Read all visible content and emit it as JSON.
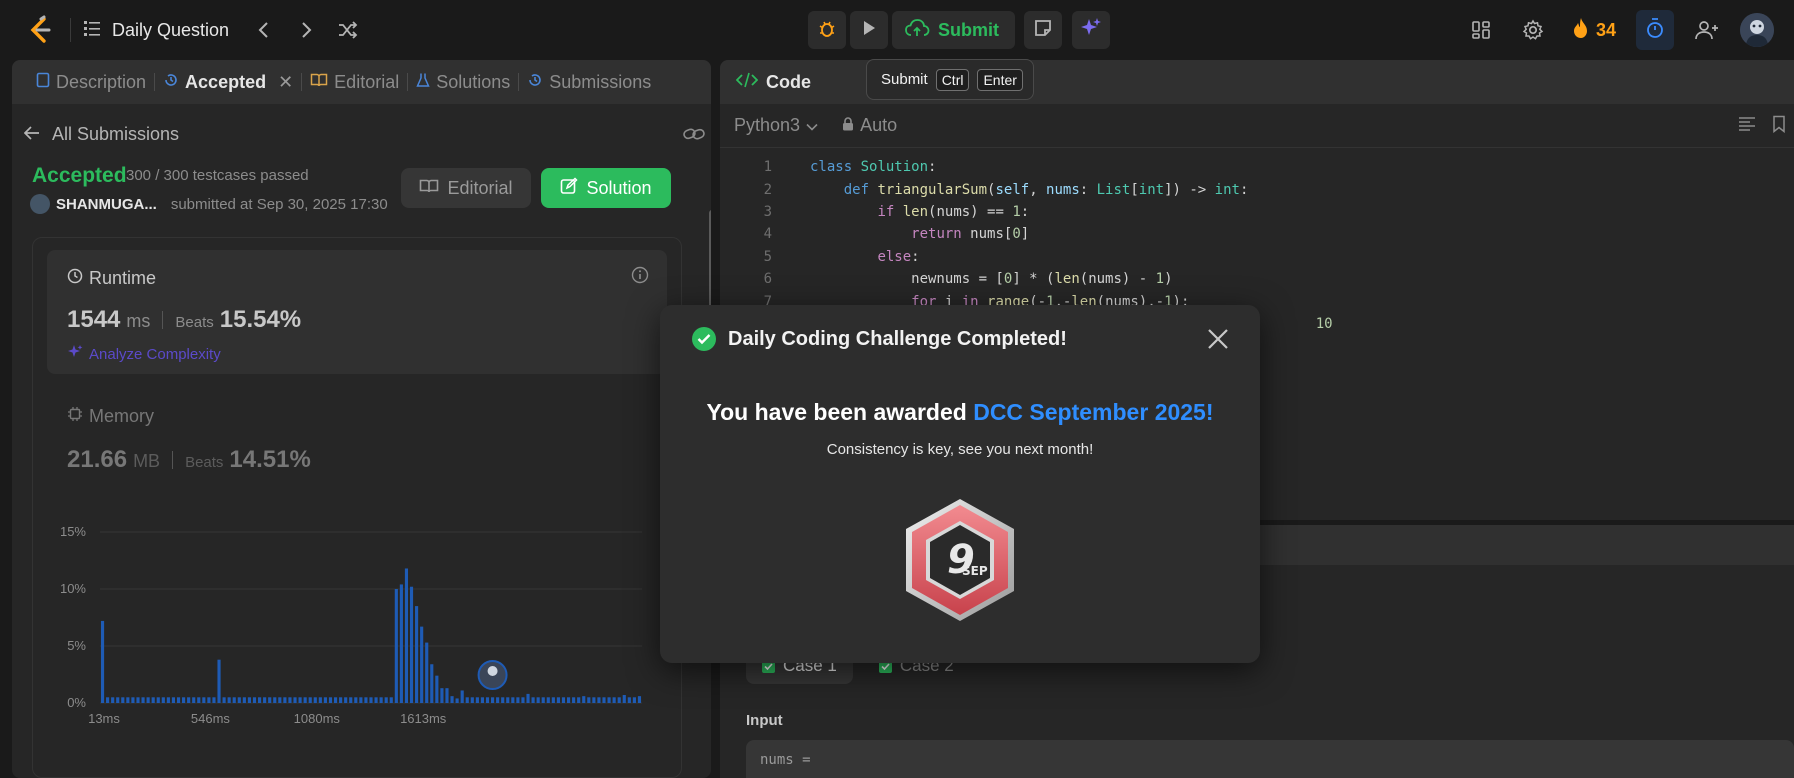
{
  "navbar": {
    "daily_question": "Daily Question",
    "submit_label": "Submit",
    "streak_count": "34"
  },
  "tooltip": {
    "label": "Submit",
    "key1": "Ctrl",
    "key2": "Enter"
  },
  "left_tabs": [
    {
      "label": "Description"
    },
    {
      "label": "Accepted"
    },
    {
      "label": "Editorial"
    },
    {
      "label": "Solutions"
    },
    {
      "label": "Submissions"
    }
  ],
  "submission": {
    "back_label": "All Submissions",
    "status": "Accepted",
    "testcases": "300 / 300 testcases passed",
    "username": "SHANMUGA...",
    "submitted_at": "submitted at Sep 30, 2025 17:30",
    "editorial_btn": "Editorial",
    "solution_btn": "Solution"
  },
  "runtime": {
    "title": "Runtime",
    "value": "1544",
    "unit": "ms",
    "beats_label": "Beats",
    "beats_value": "15.54%",
    "analyze": "Analyze Complexity"
  },
  "memory": {
    "title": "Memory",
    "value": "21.66",
    "unit": "MB",
    "beats_label": "Beats",
    "beats_value": "14.51%"
  },
  "chart_data": {
    "type": "bar",
    "title": "",
    "xlabel": "",
    "ylabel": "",
    "ylim": [
      0,
      15
    ],
    "y_ticks": [
      "15%",
      "10%",
      "5%",
      "0%"
    ],
    "x_ticks": [
      "13ms",
      "546ms",
      "1080ms",
      "1613ms"
    ],
    "series": [
      {
        "values": [
          7.2,
          0.5,
          0.5,
          0.5,
          0.5,
          0.5,
          0.5,
          0.5,
          0.5,
          0.5,
          0.5,
          0.5,
          0.5,
          0.5,
          0.5,
          0.5,
          0.5,
          0.5,
          0.5,
          0.5,
          0.5,
          0.5,
          0.5,
          3.8,
          0.5,
          0.5,
          0.5,
          0.5,
          0.5,
          0.5,
          0.5,
          0.5,
          0.5,
          0.5,
          0.5,
          0.5,
          0.5,
          0.5,
          0.5,
          0.5,
          0.5,
          0.5,
          0.5,
          0.5,
          0.5,
          0.5,
          0.5,
          0.5,
          0.5,
          0.5,
          0.5,
          0.5,
          0.5,
          0.5,
          0.5,
          0.5,
          0.5,
          0.5,
          10.0,
          10.4,
          11.8,
          10.2,
          8.5,
          6.7,
          5.3,
          3.4,
          2.4,
          1.3,
          1.3,
          0.6,
          0.4,
          1.1,
          0.5,
          0.5,
          0.5,
          0.5,
          0.5,
          0.5,
          0.5,
          0.5,
          0.5,
          0.5,
          0.5,
          0.5,
          0.8,
          0.5,
          0.5,
          0.5,
          0.5,
          0.5,
          0.5,
          0.5,
          0.5,
          0.5,
          0.5,
          0.6,
          0.5,
          0.5,
          0.5,
          0.5,
          0.5,
          0.5,
          0.5,
          0.7,
          0.5,
          0.5,
          0.6
        ]
      }
    ],
    "user_marker_index": 77,
    "bar_color": "#1e5bb5"
  },
  "code_panel": {
    "title": "Code",
    "language": "Python3",
    "auto": "Auto"
  },
  "code_lines": [
    {
      "n": "1"
    },
    {
      "n": "2"
    },
    {
      "n": "3"
    },
    {
      "n": "4"
    },
    {
      "n": "5"
    },
    {
      "n": "6"
    },
    {
      "n": "7"
    }
  ],
  "testcases": {
    "case1": "Case 1",
    "case2": "Case 2",
    "input_label": "Input",
    "input_value": "nums ="
  },
  "modal": {
    "title": "Daily Coding Challenge Completed!",
    "award_prefix": "You have been awarded ",
    "award_name": "DCC September 2025!",
    "subtitle": "Consistency is key, see you next month!",
    "badge_number": "9",
    "badge_month": "SEP"
  },
  "colors": {
    "accent_green": "#2cbb5d",
    "accent_orange": "#ffa116",
    "accent_blue": "#2f8eff",
    "bar_blue": "#1e5bb5"
  }
}
